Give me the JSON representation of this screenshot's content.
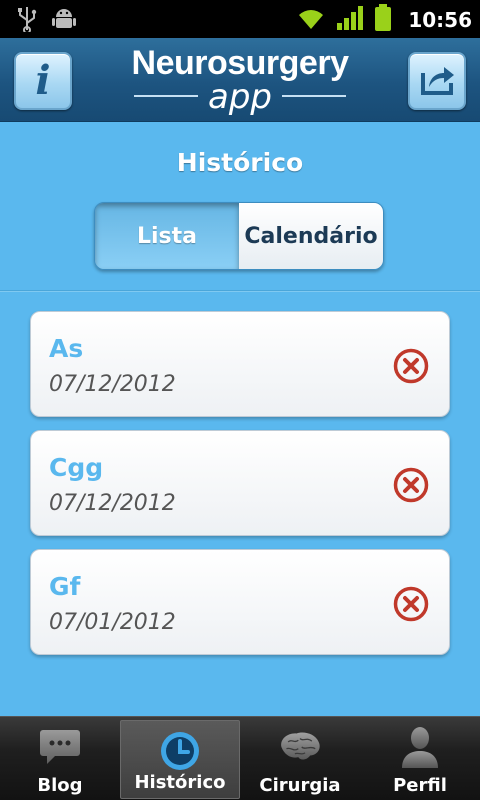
{
  "status_bar": {
    "time": "10:56",
    "icons": [
      "usb-icon",
      "android-debug-icon",
      "wifi-icon",
      "signal-icon",
      "battery-icon"
    ]
  },
  "header": {
    "logo_line1": "Neurosurgery",
    "logo_line2": "app",
    "info_button_icon": "info-icon",
    "share_button_icon": "share-icon"
  },
  "page": {
    "title": "Histórico"
  },
  "segmented": {
    "options": [
      {
        "label": "Lista",
        "selected": true
      },
      {
        "label": "Calendário",
        "selected": false
      }
    ]
  },
  "entries": [
    {
      "name": "As",
      "date": "07/12/2012"
    },
    {
      "name": "Cgg",
      "date": "07/12/2012"
    },
    {
      "name": "Gf",
      "date": "07/01/2012"
    }
  ],
  "tabs": [
    {
      "label": "Blog",
      "icon": "chat-bubble-icon",
      "active": false
    },
    {
      "label": "Histórico",
      "icon": "clock-icon",
      "active": true
    },
    {
      "label": "Cirurgia",
      "icon": "brain-icon",
      "active": false
    },
    {
      "label": "Perfil",
      "icon": "person-icon",
      "active": false
    }
  ],
  "colors": {
    "background": "#5ab8ee",
    "header": "#1d5480",
    "accent_text": "#5ab8ee",
    "delete_red": "#c0392b"
  }
}
